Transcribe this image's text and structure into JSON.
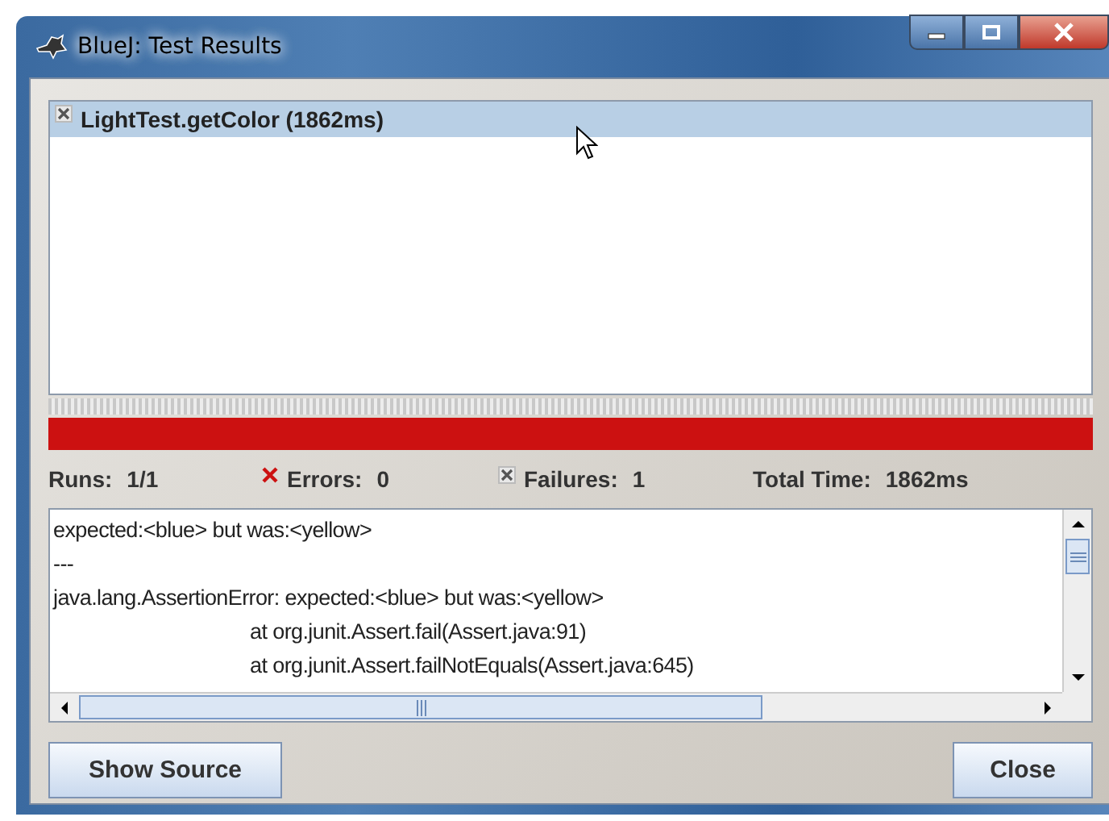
{
  "window": {
    "title": "BlueJ:  Test Results"
  },
  "results": [
    {
      "label": "LightTest.getColor (1862ms)",
      "kind": "failure",
      "selected": true
    }
  ],
  "progress": {
    "passed": false
  },
  "stats": [
    {
      "kind": "plain",
      "label": "Runs:",
      "value": "1/1"
    },
    {
      "kind": "error",
      "label": "Errors:",
      "value": "0"
    },
    {
      "kind": "failure",
      "label": "Failures:",
      "value": "1"
    },
    {
      "kind": "plain",
      "label": "Total Time:",
      "value": "1862ms"
    }
  ],
  "trace": [
    {
      "kind": "message",
      "text": "expected:<blue> but was:<yellow>"
    },
    {
      "kind": "message",
      "text": "---"
    },
    {
      "kind": "message",
      "text": "java.lang.AssertionError: expected:<blue> but was:<yellow>"
    },
    {
      "kind": "frame",
      "text": "at org.junit.Assert.fail(Assert.java:91)"
    },
    {
      "kind": "frame",
      "text": "at org.junit.Assert.failNotEquals(Assert.java:645)"
    }
  ],
  "buttons": [
    "Show Source",
    "Close"
  ]
}
